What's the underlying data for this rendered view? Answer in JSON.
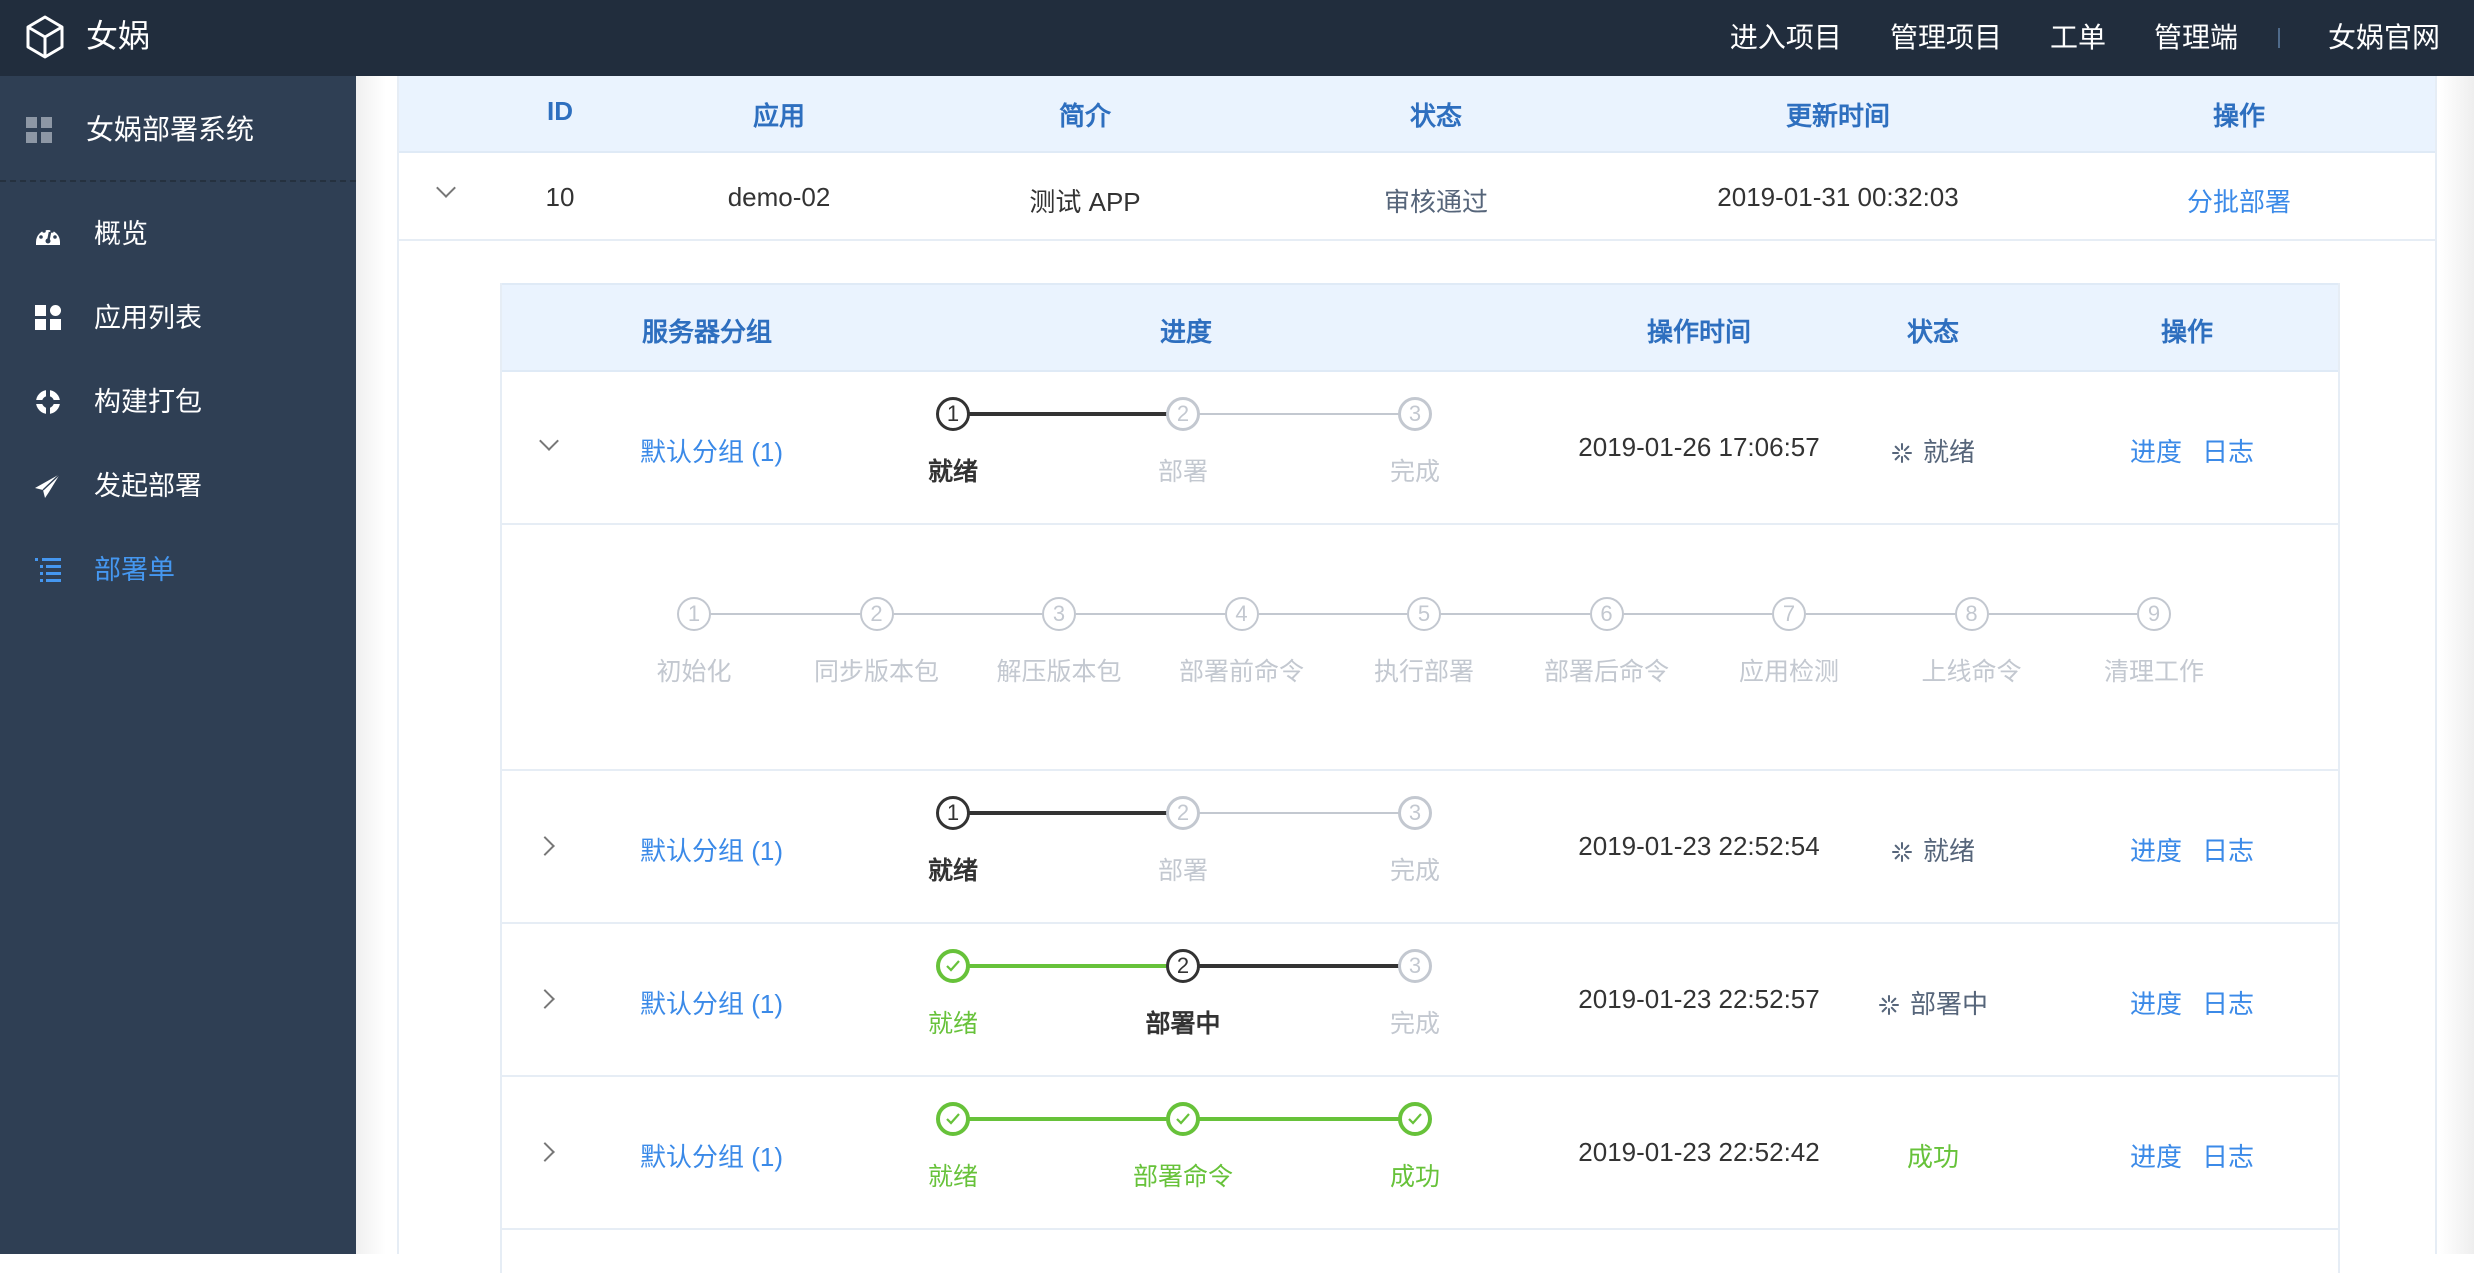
{
  "topbar": {
    "brand": "女娲",
    "nav": [
      "进入项目",
      "管理项目",
      "工单",
      "管理端"
    ],
    "official_site": "女娲官网"
  },
  "sidebar": {
    "system_title": "女娲部署系统",
    "items": [
      {
        "label": "概览",
        "icon": "dashboard-icon",
        "active": false
      },
      {
        "label": "应用列表",
        "icon": "apps-icon",
        "active": false
      },
      {
        "label": "构建打包",
        "icon": "build-icon",
        "active": false
      },
      {
        "label": "发起部署",
        "icon": "send-icon",
        "active": false
      },
      {
        "label": "部署单",
        "icon": "list-icon",
        "active": true
      }
    ]
  },
  "colors": {
    "accent": "#3b8ae8",
    "header_text": "#2e6fbf",
    "success": "#67c23a",
    "active_step": "#333333",
    "inactive_step": "#c3c8d0"
  },
  "outer_table": {
    "columns": [
      "ID",
      "应用",
      "简介",
      "状态",
      "更新时间",
      "操作"
    ],
    "rows": [
      {
        "id": "10",
        "app": "demo-02",
        "desc": "测试 APP",
        "status": "审核通过",
        "updated": "2019-01-31 00:32:03",
        "action": "分批部署",
        "expanded": true
      }
    ]
  },
  "inner_table": {
    "columns": [
      "服务器分组",
      "进度",
      "操作时间",
      "状态",
      "操作"
    ],
    "actions": [
      "进度",
      "日志"
    ],
    "rows": [
      {
        "group": "默认分组 (1)",
        "expanded": true,
        "steps": [
          {
            "num": "1",
            "label": "就绪",
            "state": "active"
          },
          {
            "num": "2",
            "label": "部署",
            "state": "wait"
          },
          {
            "num": "3",
            "label": "完成",
            "state": "wait"
          }
        ],
        "time": "2019-01-26 17:06:57",
        "status": "就绪",
        "status_type": "loading"
      },
      {
        "group": "默认分组 (1)",
        "expanded": false,
        "steps": [
          {
            "num": "1",
            "label": "就绪",
            "state": "active"
          },
          {
            "num": "2",
            "label": "部署",
            "state": "wait"
          },
          {
            "num": "3",
            "label": "完成",
            "state": "wait"
          }
        ],
        "time": "2019-01-23 22:52:54",
        "status": "就绪",
        "status_type": "loading"
      },
      {
        "group": "默认分组 (1)",
        "expanded": false,
        "steps": [
          {
            "num": "1",
            "label": "就绪",
            "state": "done"
          },
          {
            "num": "2",
            "label": "部署中",
            "state": "active"
          },
          {
            "num": "3",
            "label": "完成",
            "state": "wait"
          }
        ],
        "time": "2019-01-23 22:52:57",
        "status": "部署中",
        "status_type": "loading"
      },
      {
        "group": "默认分组 (1)",
        "expanded": false,
        "steps": [
          {
            "num": "1",
            "label": "就绪",
            "state": "done"
          },
          {
            "num": "2",
            "label": "部署命令",
            "state": "done"
          },
          {
            "num": "3",
            "label": "成功",
            "state": "done"
          }
        ],
        "time": "2019-01-23 22:52:42",
        "status": "成功",
        "status_type": "success"
      }
    ],
    "detail_steps": [
      {
        "num": "1",
        "label": "初始化"
      },
      {
        "num": "2",
        "label": "同步版本包"
      },
      {
        "num": "3",
        "label": "解压版本包"
      },
      {
        "num": "4",
        "label": "部署前命令"
      },
      {
        "num": "5",
        "label": "执行部署"
      },
      {
        "num": "6",
        "label": "部署后命令"
      },
      {
        "num": "7",
        "label": "应用检测"
      },
      {
        "num": "8",
        "label": "上线命令"
      },
      {
        "num": "9",
        "label": "清理工作"
      }
    ]
  }
}
